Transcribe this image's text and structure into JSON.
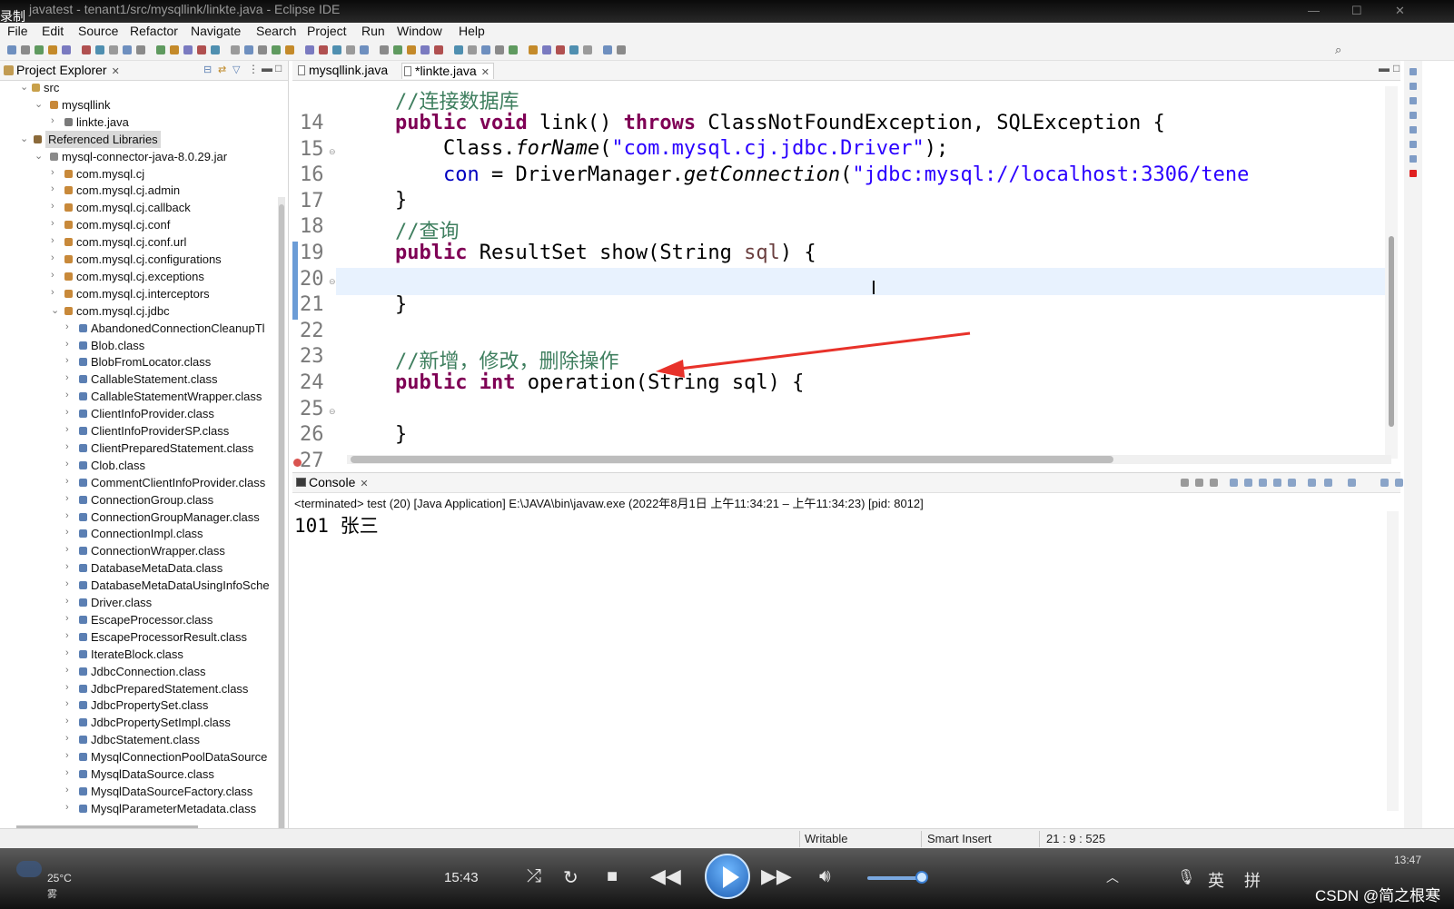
{
  "window": {
    "recording_label": "录制",
    "title": "javatest - tenant1/src/mysqllink/linkte.java - Eclipse IDE"
  },
  "menu": [
    "File",
    "Edit",
    "Source",
    "Refactor",
    "Navigate",
    "Search",
    "Project",
    "Run",
    "Window",
    "Help"
  ],
  "explorer": {
    "tab_label": "Project Explorer",
    "tree": [
      {
        "label": "src",
        "icon": "folder-icon",
        "chev": "⌄"
      },
      {
        "label": "mysqllink",
        "icon": "package-icon",
        "chev": "⌄"
      },
      {
        "label": "linkte.java",
        "icon": "java-file-icon",
        "chev": "›"
      },
      {
        "label": "Referenced Libraries",
        "icon": "library-icon",
        "chev": "⌄"
      },
      {
        "label": "mysql-connector-java-8.0.29.jar",
        "icon": "jar-icon",
        "chev": "⌄"
      },
      {
        "label": "com.mysql.cj",
        "icon": "package-icon",
        "chev": "›"
      },
      {
        "label": "com.mysql.cj.admin",
        "icon": "package-icon",
        "chev": "›"
      },
      {
        "label": "com.mysql.cj.callback",
        "icon": "package-icon",
        "chev": "›"
      },
      {
        "label": "com.mysql.cj.conf",
        "icon": "package-icon",
        "chev": "›"
      },
      {
        "label": "com.mysql.cj.conf.url",
        "icon": "package-icon",
        "chev": "›"
      },
      {
        "label": "com.mysql.cj.configurations",
        "icon": "package-icon",
        "chev": "›"
      },
      {
        "label": "com.mysql.cj.exceptions",
        "icon": "package-icon",
        "chev": "›"
      },
      {
        "label": "com.mysql.cj.interceptors",
        "icon": "package-icon",
        "chev": "›"
      },
      {
        "label": "com.mysql.cj.jdbc",
        "icon": "package-icon",
        "chev": "⌄"
      },
      {
        "label": "AbandonedConnectionCleanupTl",
        "icon": "class-file-icon",
        "chev": "›"
      },
      {
        "label": "Blob.class",
        "icon": "class-file-icon",
        "chev": "›"
      },
      {
        "label": "BlobFromLocator.class",
        "icon": "class-file-icon",
        "chev": "›"
      },
      {
        "label": "CallableStatement.class",
        "icon": "class-file-icon",
        "chev": "›"
      },
      {
        "label": "CallableStatementWrapper.class",
        "icon": "class-file-icon",
        "chev": "›"
      },
      {
        "label": "ClientInfoProvider.class",
        "icon": "class-file-icon",
        "chev": "›"
      },
      {
        "label": "ClientInfoProviderSP.class",
        "icon": "class-file-icon",
        "chev": "›"
      },
      {
        "label": "ClientPreparedStatement.class",
        "icon": "class-file-icon",
        "chev": "›"
      },
      {
        "label": "Clob.class",
        "icon": "class-file-icon",
        "chev": "›"
      },
      {
        "label": "CommentClientInfoProvider.class",
        "icon": "class-file-icon",
        "chev": "›"
      },
      {
        "label": "ConnectionGroup.class",
        "icon": "class-file-icon",
        "chev": "›"
      },
      {
        "label": "ConnectionGroupManager.class",
        "icon": "class-file-icon",
        "chev": "›"
      },
      {
        "label": "ConnectionImpl.class",
        "icon": "class-file-icon",
        "chev": "›"
      },
      {
        "label": "ConnectionWrapper.class",
        "icon": "class-file-icon",
        "chev": "›"
      },
      {
        "label": "DatabaseMetaData.class",
        "icon": "class-file-icon",
        "chev": "›"
      },
      {
        "label": "DatabaseMetaDataUsingInfoSche",
        "icon": "class-file-icon",
        "chev": "›"
      },
      {
        "label": "Driver.class",
        "icon": "class-file-icon",
        "chev": "›"
      },
      {
        "label": "EscapeProcessor.class",
        "icon": "class-file-icon",
        "chev": "›"
      },
      {
        "label": "EscapeProcessorResult.class",
        "icon": "class-file-icon",
        "chev": "›"
      },
      {
        "label": "IterateBlock.class",
        "icon": "class-file-icon",
        "chev": "›"
      },
      {
        "label": "JdbcConnection.class",
        "icon": "class-file-icon",
        "chev": "›"
      },
      {
        "label": "JdbcPreparedStatement.class",
        "icon": "class-file-icon",
        "chev": "›"
      },
      {
        "label": "JdbcPropertySet.class",
        "icon": "class-file-icon",
        "chev": "›"
      },
      {
        "label": "JdbcPropertySetImpl.class",
        "icon": "class-file-icon",
        "chev": "›"
      },
      {
        "label": "JdbcStatement.class",
        "icon": "class-file-icon",
        "chev": "›"
      },
      {
        "label": "MysqlConnectionPoolDataSource",
        "icon": "class-file-icon",
        "chev": "›"
      },
      {
        "label": "MysqlDataSource.class",
        "icon": "class-file-icon",
        "chev": "›"
      },
      {
        "label": "MysqlDataSourceFactory.class",
        "icon": "class-file-icon",
        "chev": "›"
      },
      {
        "label": "MysqlParameterMetadata.class",
        "icon": "class-file-icon",
        "chev": "›"
      }
    ]
  },
  "editor": {
    "tabs": [
      {
        "label": "mysqllink.java",
        "active": false
      },
      {
        "label": "*linkte.java",
        "active": true
      }
    ],
    "lines": [
      {
        "num": "14",
        "tokens": [
          {
            "t": "    "
          },
          {
            "t": "//连接数据库",
            "c": "cm"
          }
        ]
      },
      {
        "num": "15",
        "fold": true,
        "tokens": [
          {
            "t": "    "
          },
          {
            "t": "public",
            "c": "kw"
          },
          {
            "t": " "
          },
          {
            "t": "void",
            "c": "kw"
          },
          {
            "t": " link() "
          },
          {
            "t": "throws",
            "c": "kw"
          },
          {
            "t": " ClassNotFoundException, SQLException {"
          }
        ]
      },
      {
        "num": "16",
        "tokens": [
          {
            "t": "        Class."
          },
          {
            "t": "forName",
            "c": "it"
          },
          {
            "t": "("
          },
          {
            "t": "\"com.mysql.cj.jdbc.Driver\"",
            "c": "str"
          },
          {
            "t": ");"
          }
        ]
      },
      {
        "num": "17",
        "tokens": [
          {
            "t": "        "
          },
          {
            "t": "con",
            "c": "fld"
          },
          {
            "t": " = DriverManager."
          },
          {
            "t": "getConnection",
            "c": "it"
          },
          {
            "t": "("
          },
          {
            "t": "\"jdbc:mysql://localhost:3306/tene",
            "c": "str"
          }
        ]
      },
      {
        "num": "18",
        "tokens": [
          {
            "t": "    }"
          }
        ]
      },
      {
        "num": "19",
        "tokens": [
          {
            "t": "    "
          },
          {
            "t": "//查询",
            "c": "cm"
          }
        ]
      },
      {
        "num": "20",
        "fold": true,
        "tokens": [
          {
            "t": "    "
          },
          {
            "t": "public",
            "c": "kw"
          },
          {
            "t": " ResultSet show(String "
          },
          {
            "t": "sql",
            "c": "param"
          },
          {
            "t": ") {"
          }
        ]
      },
      {
        "num": "21",
        "tokens": [
          {
            "t": ""
          }
        ]
      },
      {
        "num": "22",
        "tokens": [
          {
            "t": "    }"
          }
        ]
      },
      {
        "num": "23",
        "tokens": [
          {
            "t": ""
          }
        ]
      },
      {
        "num": "24",
        "tokens": [
          {
            "t": "    "
          },
          {
            "t": "//新增，修改，删除操作",
            "c": "cm"
          }
        ]
      },
      {
        "num": "25",
        "fold": true,
        "tokens": [
          {
            "t": "    "
          },
          {
            "t": "public",
            "c": "kw"
          },
          {
            "t": " "
          },
          {
            "t": "int",
            "c": "kw"
          },
          {
            "t": " operation(String sql) {"
          }
        ]
      },
      {
        "num": "26",
        "tokens": [
          {
            "t": ""
          }
        ]
      },
      {
        "num": "27",
        "error": true,
        "tokens": [
          {
            "t": "    }"
          }
        ]
      }
    ]
  },
  "console": {
    "tab_label": "Console",
    "status": "<terminated> test (20) [Java Application] E:\\JAVA\\bin\\javaw.exe  (2022年8月1日 上午11:34:21 – 上午11:34:23) [pid: 8012]",
    "output": "101 张三"
  },
  "statusbar": {
    "writable": "Writable",
    "insert_mode": "Smart Insert",
    "position": "21 : 9 : 525"
  },
  "player": {
    "time": "15:43",
    "weather_temp": "25°C",
    "weather_desc": "雾",
    "clock": "13:47",
    "watermark": "CSDN @简之根寒",
    "ime_lang": "英",
    "ime_mode": "拼"
  },
  "colors": {
    "keyword": "#7f0055",
    "comment": "#3f7f5f",
    "string": "#2a00ff",
    "annotation_arrow": "#e8322a"
  }
}
